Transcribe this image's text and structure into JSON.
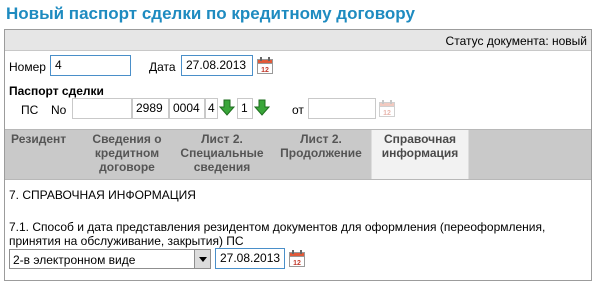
{
  "page": {
    "title": "Новый паспорт сделки по кредитному договору"
  },
  "status": {
    "text": "Статус документа: новый"
  },
  "header": {
    "number_label": "Номер",
    "number_value": "4",
    "date_label": "Дата",
    "date_value": "27.08.2013"
  },
  "passport": {
    "heading": "Паспорт сделки",
    "ps_label": "ПС",
    "no_label": "No",
    "field1": "",
    "field2": "2989",
    "field3": "0004",
    "field4": "4",
    "field5": "1",
    "from_label": "от",
    "from_value": ""
  },
  "tabs": [
    {
      "label": "Резидент"
    },
    {
      "label": "Сведения о кредитном договоре"
    },
    {
      "label": "Лист 2. Специальные сведения"
    },
    {
      "label": "Лист 2. Продолжение"
    },
    {
      "label": "Справочная информация",
      "active": true
    }
  ],
  "content": {
    "section_title": "7. СПРАВОЧНАЯ ИНФОРМАЦИЯ",
    "question": "7.1. Способ и дата представления резидентом документов для оформления (переоформления, принятия на обслуживание, закрытия) ПС",
    "method_selected": "2-в электронном виде",
    "method_date": "27.08.2013"
  },
  "icons": {
    "calendar": "calendar-icon",
    "down_arrow": "green-down-arrow-icon",
    "dropdown": "chevron-down-icon"
  },
  "colors": {
    "title": "#1e8bc0",
    "input_border": "#4a8fc9",
    "tabs_bg": "#c9c9c9",
    "arrow_green": "#3aa63a"
  }
}
